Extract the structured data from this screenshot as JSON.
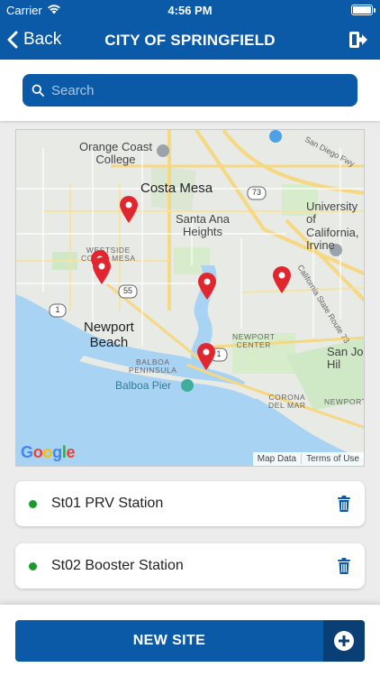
{
  "status_bar": {
    "carrier": "Carrier",
    "time": "4:56 PM"
  },
  "nav": {
    "back_label": "Back",
    "title": "CITY OF SPRINGFIELD"
  },
  "search": {
    "placeholder": "Search"
  },
  "map": {
    "labels": {
      "orange_coast": "Orange Coast\nCollege",
      "costa_mesa": "Costa Mesa",
      "santa_ana_heights": "Santa Ana\nHeights",
      "university_irvine": "University\nof California,\nIrvine",
      "westside": "WESTSIDE\nCOSTA MESA",
      "newport_beach": "Newport\nBeach",
      "newport_center": "NEWPORT\nCENTER",
      "san_joaquin": "San Jo\nHil",
      "balboa_peninsula": "BALBOA\nPENINSULA",
      "balboa_pier": "Balboa Pier",
      "corona_del_mar": "CORONA\nDEL MAR",
      "newport_coast": "NEWPORT",
      "ca_route_73": "California State Route 73",
      "san_diego_fwy": "San Diego Fwy",
      "route_55": "55",
      "route_73": "73",
      "route_1a": "1",
      "route_1b": "1"
    },
    "google_logo": "Google",
    "map_data": "Map Data",
    "terms": "Terms of Use",
    "colors": {
      "water": "#a9d3f2",
      "park": "#cfe8c6",
      "road": "#f6d883",
      "pin": "#e2262f"
    }
  },
  "sites": [
    {
      "name": "St01 PRV Station",
      "status_color": "#1a9a2c"
    },
    {
      "name": "St02 Booster Station",
      "status_color": "#1a9a2c"
    }
  ],
  "footer": {
    "new_site_label": "NEW SITE"
  },
  "theme": {
    "primary": "#0b5aa8",
    "primary_dark": "#0a3f75"
  }
}
